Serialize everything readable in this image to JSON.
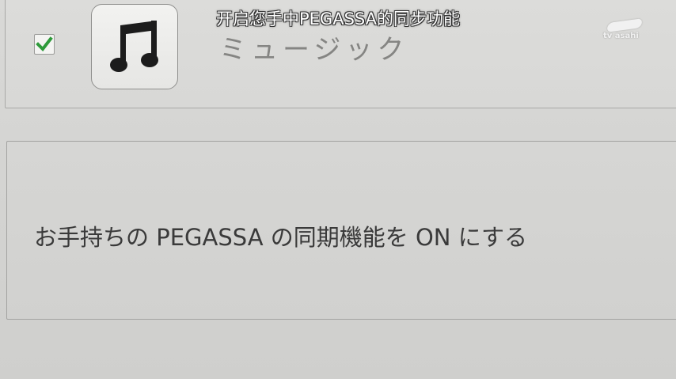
{
  "sync_list": {
    "item": {
      "checked": true,
      "icon": "music-note-icon",
      "label": "ミュージック"
    }
  },
  "message": {
    "text": "お手持ちの PEGASSA の同期機能を ON にする"
  },
  "overlay": {
    "subtitle": "开启您手中PEGASSA的同步功能",
    "channel_logo": "tv asahi"
  },
  "colors": {
    "check": "#2e9a3a",
    "label": "#858583",
    "message": "#3a3a3a"
  }
}
